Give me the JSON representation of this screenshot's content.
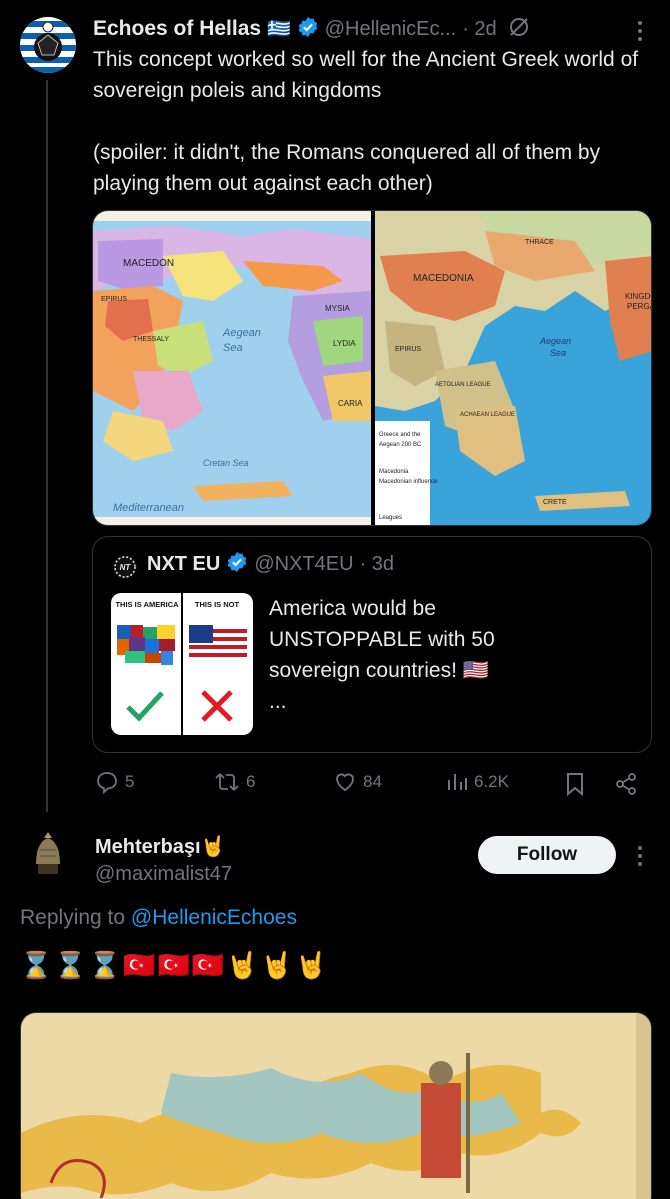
{
  "tweet": {
    "author_name": "Echoes of Hellas",
    "author_flag": "🇬🇷",
    "handle": "@HellenicEc...",
    "time": "· 2d",
    "text": "This concept worked so well for the Ancient Greek world of sovereign poleis and kingdoms\n\n(spoiler: it didn't, the Romans conquered all of them by playing them out against each other)",
    "more_icon": "more-vertical-icon",
    "grok_icon": "no-repost-icon",
    "map_left_labels": [
      "MACEDON",
      "EPIRUS",
      "THESSALY",
      "Aegean Sea",
      "Mediterranean",
      "Cretan Sea",
      "MYSIA",
      "LYDIA",
      "CARIA"
    ],
    "map_right_labels": [
      "THRACE",
      "MACEDONIA",
      "EPIRUS",
      "Aegean Sea",
      "KINGDOM PERGA",
      "CRETE",
      "AETOLIAN LEAGUE",
      "ACHAEAN LEAGUE"
    ],
    "map_right_legend": [
      "Macedonia",
      "Macedonian influence",
      "Leagues"
    ],
    "actions": {
      "replies": "5",
      "reposts": "6",
      "likes": "84",
      "views": "6.2K"
    }
  },
  "quote": {
    "author_name": "NXT EU",
    "handle": "@NXT4EU",
    "time": "· 3d",
    "text": "America would be UNSTOPPABLE with 50 sovereign countries! 🇺🇸\n...",
    "image_left_label": "THIS IS AMERICA",
    "image_right_label": "THIS IS NOT"
  },
  "reply": {
    "author_name": "Mehterbaşı🤘",
    "handle": "@maximalist47",
    "follow_label": "Follow",
    "replying_to_prefix": "Replying to ",
    "replying_to_handle": "@HellenicEchoes",
    "text": "⌛⌛⌛🇹🇷🇹🇷🇹🇷🤘🤘🤘"
  },
  "colors": {
    "accent": "#1d9bf0",
    "muted": "#71767b",
    "background": "#000000",
    "border": "#2f3336"
  }
}
